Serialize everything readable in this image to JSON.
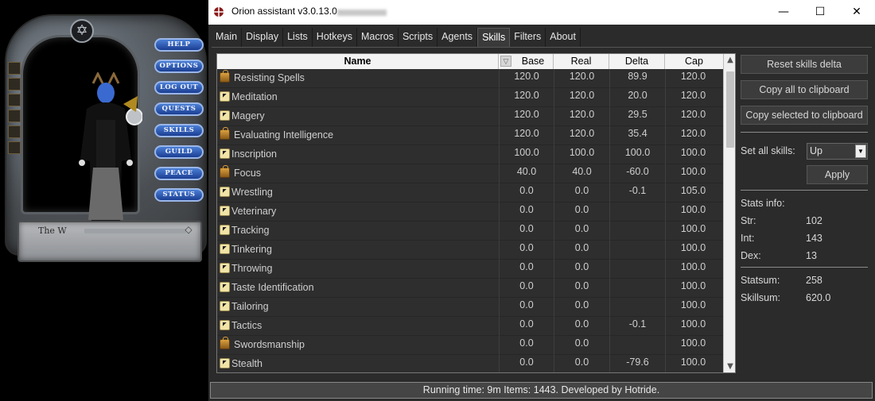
{
  "paperdoll": {
    "name_text": "The W",
    "buttons": [
      "HELP",
      "OPTIONS",
      "LOG OUT",
      "QUESTS",
      "SKILLS",
      "GUILD",
      "PEACE",
      "STATUS"
    ]
  },
  "window": {
    "title": "Orion assistant v3.0.13.0 -",
    "controls": {
      "minimize": "—",
      "maximize": "☐",
      "close": "✕"
    }
  },
  "tabs": [
    "Main",
    "Display",
    "Lists",
    "Hotkeys",
    "Macros",
    "Scripts",
    "Agents",
    "Skills",
    "Filters",
    "About"
  ],
  "active_tab": "Skills",
  "table": {
    "headers": {
      "name": "Name",
      "base": "Base",
      "real": "Real",
      "delta": "Delta",
      "cap": "Cap"
    },
    "rows": [
      {
        "lock": "locked",
        "name": "Resisting Spells",
        "base": "120.0",
        "real": "120.0",
        "delta": "89.9",
        "cap": "120.0"
      },
      {
        "lock": "up",
        "name": "Meditation",
        "base": "120.0",
        "real": "120.0",
        "delta": "20.0",
        "cap": "120.0"
      },
      {
        "lock": "up",
        "name": "Magery",
        "base": "120.0",
        "real": "120.0",
        "delta": "29.5",
        "cap": "120.0"
      },
      {
        "lock": "locked",
        "name": "Evaluating Intelligence",
        "base": "120.0",
        "real": "120.0",
        "delta": "35.4",
        "cap": "120.0"
      },
      {
        "lock": "up",
        "name": "Inscription",
        "base": "100.0",
        "real": "100.0",
        "delta": "100.0",
        "cap": "100.0"
      },
      {
        "lock": "locked",
        "name": "Focus",
        "base": "40.0",
        "real": "40.0",
        "delta": "-60.0",
        "cap": "100.0"
      },
      {
        "lock": "up",
        "name": "Wrestling",
        "base": "0.0",
        "real": "0.0",
        "delta": "-0.1",
        "cap": "105.0"
      },
      {
        "lock": "up",
        "name": "Veterinary",
        "base": "0.0",
        "real": "0.0",
        "delta": "",
        "cap": "100.0"
      },
      {
        "lock": "up",
        "name": "Tracking",
        "base": "0.0",
        "real": "0.0",
        "delta": "",
        "cap": "100.0"
      },
      {
        "lock": "up",
        "name": "Tinkering",
        "base": "0.0",
        "real": "0.0",
        "delta": "",
        "cap": "100.0"
      },
      {
        "lock": "up",
        "name": "Throwing",
        "base": "0.0",
        "real": "0.0",
        "delta": "",
        "cap": "100.0"
      },
      {
        "lock": "up",
        "name": "Taste Identification",
        "base": "0.0",
        "real": "0.0",
        "delta": "",
        "cap": "100.0"
      },
      {
        "lock": "up",
        "name": "Tailoring",
        "base": "0.0",
        "real": "0.0",
        "delta": "",
        "cap": "100.0"
      },
      {
        "lock": "up",
        "name": "Tactics",
        "base": "0.0",
        "real": "0.0",
        "delta": "-0.1",
        "cap": "100.0"
      },
      {
        "lock": "locked",
        "name": "Swordsmanship",
        "base": "0.0",
        "real": "0.0",
        "delta": "",
        "cap": "100.0"
      },
      {
        "lock": "up",
        "name": "Stealth",
        "base": "0.0",
        "real": "0.0",
        "delta": "-79.6",
        "cap": "100.0"
      }
    ]
  },
  "panel": {
    "reset_delta": "Reset skills delta",
    "copy_all": "Copy all to clipboard",
    "copy_selected": "Copy selected to clipboard",
    "set_all_label": "Set all skills:",
    "set_all_value": "Up",
    "apply": "Apply",
    "stats_title": "Stats info:",
    "str_label": "Str:",
    "str_value": "102",
    "int_label": "Int:",
    "int_value": "143",
    "dex_label": "Dex:",
    "dex_value": "13",
    "statsum_label": "Statsum:",
    "statsum_value": "258",
    "skillsum_label": "Skillsum:",
    "skillsum_value": "620.0"
  },
  "status_bar": "Running time: 9m Items: 1443. Developed by Hotride."
}
